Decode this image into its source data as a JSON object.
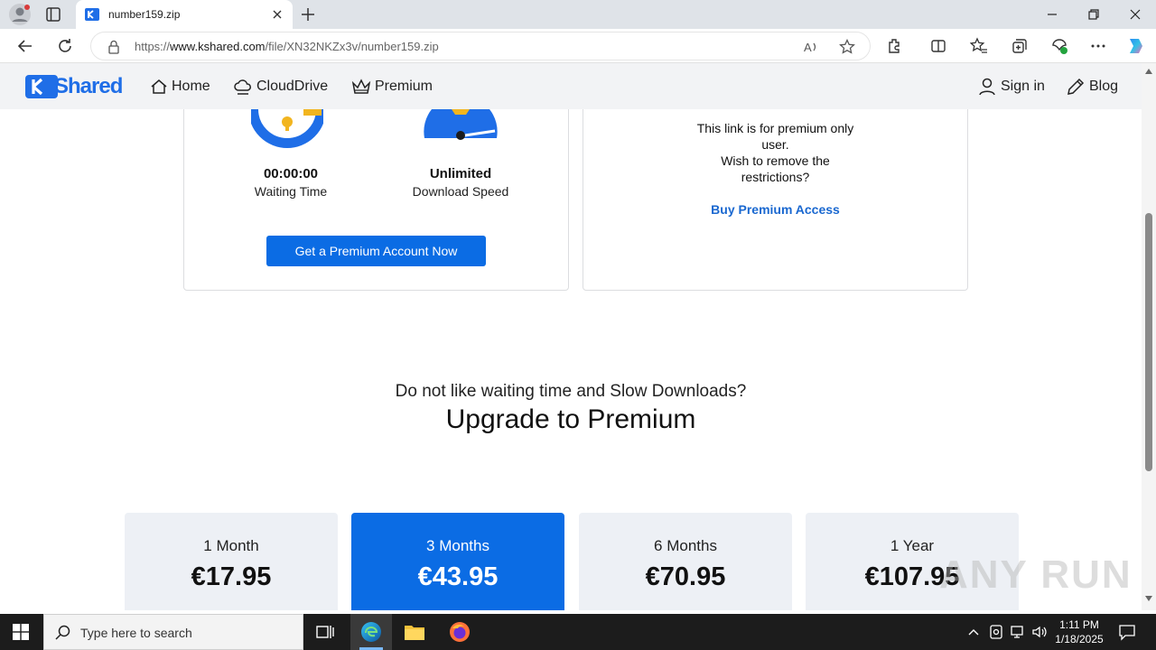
{
  "browser": {
    "tab_title": "number159.zip",
    "url_prefix": "https://",
    "url_domain": "www.kshared.com",
    "url_path": "/file/XN32NKZx3v/number159.zip"
  },
  "site": {
    "logo_text": "Shared",
    "nav": {
      "home": "Home",
      "clouddrive": "CloudDrive",
      "premium": "Premium",
      "signin": "Sign in",
      "blog": "Blog"
    }
  },
  "free_card": {
    "waiting_value": "00:00:00",
    "waiting_label": "Waiting Time",
    "speed_value": "Unlimited",
    "speed_label": "Download Speed",
    "cta": "Get a Premium Account Now"
  },
  "premium_notice": {
    "line1": "This link is for premium only",
    "line2": "user.",
    "line3": "Wish to remove the",
    "line4": "restrictions?",
    "link": "Buy Premium Access"
  },
  "upsell": {
    "question": "Do not like waiting time and Slow Downloads?",
    "heading": "Upgrade to Premium"
  },
  "plans": [
    {
      "name": "1 Month",
      "price": "€17.95",
      "selected": false
    },
    {
      "name": "3 Months",
      "price": "€43.95",
      "selected": true
    },
    {
      "name": "6 Months",
      "price": "€70.95",
      "selected": false
    },
    {
      "name": "1 Year",
      "price": "€107.95",
      "selected": false
    }
  ],
  "watermark": "ANY RUN",
  "taskbar": {
    "search_placeholder": "Type here to search",
    "time": "1:11 PM",
    "date": "1/18/2025"
  },
  "colors": {
    "accent": "#0b6ce4",
    "gauge_blue": "#1f6ee7",
    "gauge_gold": "#f2b51f"
  }
}
